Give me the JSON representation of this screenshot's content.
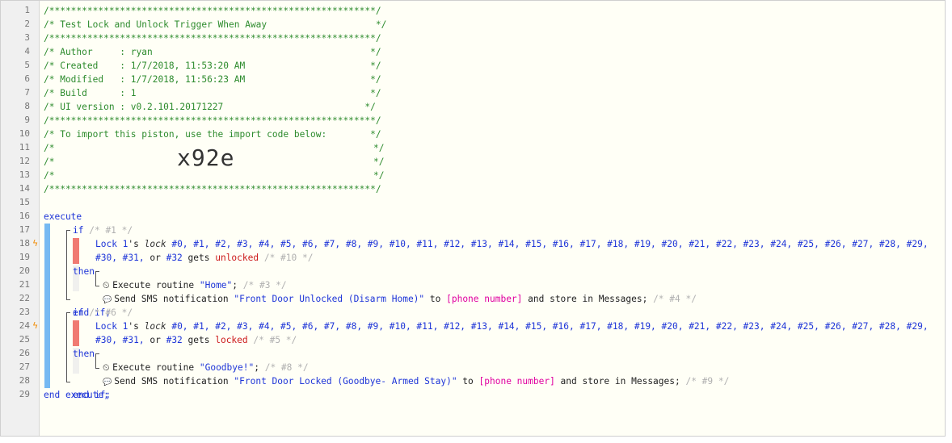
{
  "header_comment": {
    "border": "/************************************************************/",
    "title": "/* Test Lock and Unlock Trigger When Away                    */",
    "author": "/* Author     : ryan                                        */",
    "created": "/* Created    : 1/7/2018, 11:53:20 AM                       */",
    "modified": "/* Modified   : 1/7/2018, 11:56:23 AM                       */",
    "build": "/* Build      : 1                                           */",
    "ui_version": "/* UI version : v0.2.101.20171227                          */",
    "import_note": "/* To import this piston, use the import code below:        */",
    "blank_open": "/*",
    "blank_close": "*/",
    "import_code": "x92e"
  },
  "line_numbers": [
    "1",
    "2",
    "3",
    "4",
    "5",
    "6",
    "7",
    "8",
    "9",
    "10",
    "11",
    "12",
    "13",
    "14",
    "15",
    "16",
    "17",
    "18",
    "19",
    "20",
    "21",
    "22",
    "23",
    "24",
    "25",
    "26",
    "27",
    "28",
    "29"
  ],
  "code": {
    "execute": "execute",
    "end_execute": "end execute;",
    "if1": {
      "kw": "if",
      "comment": "/* #1 */",
      "device": "Lock 1",
      "possessive": "'s ",
      "attr": "lock",
      "list1": " #0, #1, #2, #3, #4, #5, #6, #7, #8, #9, #10, #11, #12, #13, #14, #15, #16, #17, #18, #19, #20, #21, #22, #23, #24, #25, #26, #27, #28, #29,",
      "list2a": "#30, #31,",
      "or": " or ",
      "list2b": "#32",
      "gets": " gets ",
      "value": "unlocked",
      "cond_comment": " /* #10 */",
      "then": "then",
      "action1_prefix": "Execute routine ",
      "action1_value": "\"Home\"",
      "action1_suffix": "; ",
      "action1_comment": "/* #3 */",
      "action2_prefix": "Send SMS notification ",
      "action2_value": "\"Front Door Unlocked (Disarm Home)\"",
      "action2_mid": " to ",
      "action2_target": "[phone number]",
      "action2_suffix": " and store in Messages; ",
      "action2_comment": "/* #4 */",
      "end": "end if;"
    },
    "if2": {
      "kw": "if",
      "comment": "/* #6 */",
      "device": "Lock 1",
      "possessive": "'s ",
      "attr": "lock",
      "list1": " #0, #1, #2, #3, #4, #5, #6, #7, #8, #9, #10, #11, #12, #13, #14, #15, #16, #17, #18, #19, #20, #21, #22, #23, #24, #25, #26, #27, #28, #29,",
      "list2a": "#30, #31,",
      "or": " or ",
      "list2b": "#32",
      "gets": " gets ",
      "value": "locked",
      "cond_comment": " /* #5 */",
      "then": "then",
      "action1_prefix": "Execute routine ",
      "action1_value": "\"Goodbye!\"",
      "action1_suffix": "; ",
      "action1_comment": "/* #8 */",
      "action2_prefix": "Send SMS notification ",
      "action2_value": "\"Front Door Locked (Goodbye- Armed Stay)\"",
      "action2_mid": " to ",
      "action2_target": "[phone number]",
      "action2_suffix": " and store in Messages; ",
      "action2_comment": "/* #9 */",
      "end": "end if;"
    }
  },
  "icons": {
    "trigger": "lightning-icon",
    "routine": "clock-icon",
    "sms": "speech-bubble-icon"
  },
  "colors": {
    "comment": "#2d8b2d",
    "keyword": "#1e35d8",
    "variable": "#e000a0",
    "condition_marker": "#f07a72",
    "block_bar": "#76b9f2"
  }
}
